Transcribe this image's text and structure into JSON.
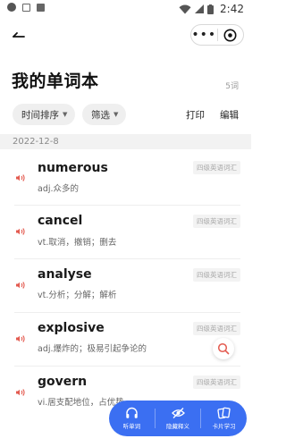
{
  "statusbar": {
    "time": "2:42"
  },
  "page": {
    "title": "我的单词本",
    "count": "5词"
  },
  "filters": {
    "sort_label": "时间排序",
    "filter_label": "筛选"
  },
  "actions": {
    "print": "打印",
    "edit": "编辑"
  },
  "date_header": "2022-12-8",
  "words": [
    {
      "word": "numerous",
      "meaning": "adj.众多的",
      "tag": "四级英语词汇"
    },
    {
      "word": "cancel",
      "meaning": "vt.取消，撤销；删去",
      "tag": "四级英语词汇"
    },
    {
      "word": "analyse",
      "meaning": "vt.分析；分解；解析",
      "tag": "四级英语词汇"
    },
    {
      "word": "explosive",
      "meaning": "adj.爆炸的；极易引起争论的",
      "tag": "四级英语词汇"
    },
    {
      "word": "govern",
      "meaning": "vi.居支配地位，占优势",
      "tag": "四级英语词汇"
    }
  ],
  "toolbar": {
    "listen": "听单词",
    "hide": "隐藏释义",
    "card": "卡片学习"
  },
  "colors": {
    "accent": "#3b6ff2",
    "speaker": "#e35a4f"
  }
}
